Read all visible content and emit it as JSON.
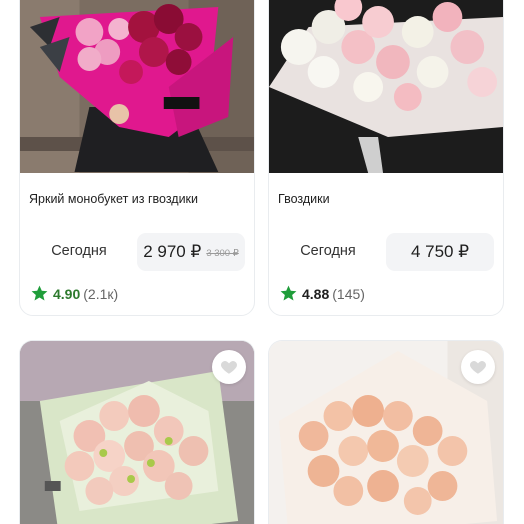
{
  "products": [
    {
      "title": "Яркий монобукет из гвоздики",
      "delivery": "Сегодня",
      "price": "2 970 ₽",
      "old_price": "3 300 ₽",
      "rating": "4.90",
      "reviews": "(2.1к)",
      "image": "pink-carnation-bouquet-photo"
    },
    {
      "title": "Гвоздики",
      "delivery": "Сегодня",
      "price": "4 750 ₽",
      "old_price": "",
      "rating": "4.88",
      "reviews": "(145)",
      "image": "white-pink-carnation-bouquet-photo"
    },
    {
      "image": "peach-green-carnation-bouquet-photo",
      "favorite_icon": "heart-icon"
    },
    {
      "image": "peach-carnation-bouquet-photo",
      "favorite_icon": "heart-icon"
    }
  ],
  "colors": {
    "star": "#1f9d3a",
    "price_bg": "#f3f4f6",
    "heart": "#d9d9d9"
  },
  "icons": {
    "rating": "star-icon",
    "favorite": "heart-icon"
  }
}
